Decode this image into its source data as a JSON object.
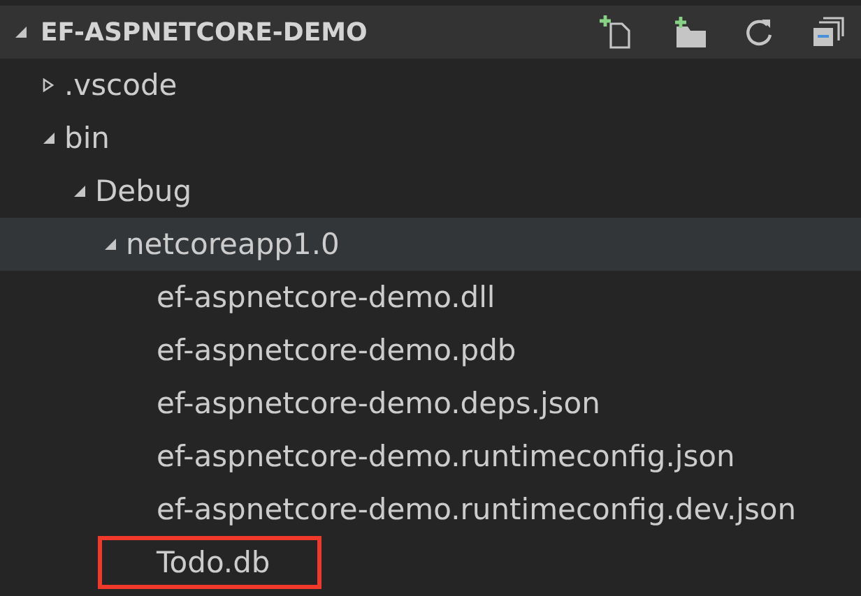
{
  "explorer": {
    "title": "EF-ASPNETCORE-DEMO",
    "expanded": true
  },
  "tree": [
    {
      "kind": "folder",
      "name": ".vscode",
      "expanded": false,
      "selected": false,
      "highlighted": false
    },
    {
      "kind": "folder",
      "name": "bin",
      "expanded": true,
      "selected": false,
      "highlighted": false,
      "children": [
        {
          "kind": "folder",
          "name": "Debug",
          "expanded": true,
          "selected": false,
          "highlighted": false,
          "children": [
            {
              "kind": "folder",
              "name": "netcoreapp1.0",
              "expanded": true,
              "selected": true,
              "highlighted": false,
              "children": [
                {
                  "kind": "file",
                  "name": "ef-aspnetcore-demo.dll",
                  "selected": false,
                  "highlighted": false
                },
                {
                  "kind": "file",
                  "name": "ef-aspnetcore-demo.pdb",
                  "selected": false,
                  "highlighted": false
                },
                {
                  "kind": "file",
                  "name": "ef-aspnetcore-demo.deps.json",
                  "selected": false,
                  "highlighted": false
                },
                {
                  "kind": "file",
                  "name": "ef-aspnetcore-demo.runtimeconfig.json",
                  "selected": false,
                  "highlighted": false
                },
                {
                  "kind": "file",
                  "name": "ef-aspnetcore-demo.runtimeconfig.dev.json",
                  "selected": false,
                  "highlighted": false
                },
                {
                  "kind": "file",
                  "name": "Todo.db",
                  "selected": false,
                  "highlighted": true
                }
              ]
            }
          ]
        }
      ]
    }
  ]
}
